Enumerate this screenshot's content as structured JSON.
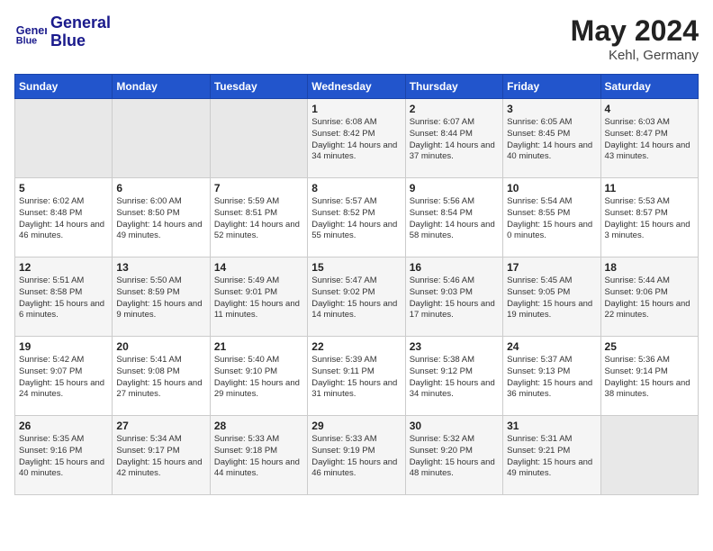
{
  "header": {
    "logo_text_top": "General",
    "logo_text_bottom": "Blue",
    "month_year": "May 2024",
    "location": "Kehl, Germany"
  },
  "days_of_week": [
    "Sunday",
    "Monday",
    "Tuesday",
    "Wednesday",
    "Thursday",
    "Friday",
    "Saturday"
  ],
  "weeks": [
    [
      {
        "num": "",
        "info": ""
      },
      {
        "num": "",
        "info": ""
      },
      {
        "num": "",
        "info": ""
      },
      {
        "num": "1",
        "info": "Sunrise: 6:08 AM\nSunset: 8:42 PM\nDaylight: 14 hours\nand 34 minutes."
      },
      {
        "num": "2",
        "info": "Sunrise: 6:07 AM\nSunset: 8:44 PM\nDaylight: 14 hours\nand 37 minutes."
      },
      {
        "num": "3",
        "info": "Sunrise: 6:05 AM\nSunset: 8:45 PM\nDaylight: 14 hours\nand 40 minutes."
      },
      {
        "num": "4",
        "info": "Sunrise: 6:03 AM\nSunset: 8:47 PM\nDaylight: 14 hours\nand 43 minutes."
      }
    ],
    [
      {
        "num": "5",
        "info": "Sunrise: 6:02 AM\nSunset: 8:48 PM\nDaylight: 14 hours\nand 46 minutes."
      },
      {
        "num": "6",
        "info": "Sunrise: 6:00 AM\nSunset: 8:50 PM\nDaylight: 14 hours\nand 49 minutes."
      },
      {
        "num": "7",
        "info": "Sunrise: 5:59 AM\nSunset: 8:51 PM\nDaylight: 14 hours\nand 52 minutes."
      },
      {
        "num": "8",
        "info": "Sunrise: 5:57 AM\nSunset: 8:52 PM\nDaylight: 14 hours\nand 55 minutes."
      },
      {
        "num": "9",
        "info": "Sunrise: 5:56 AM\nSunset: 8:54 PM\nDaylight: 14 hours\nand 58 minutes."
      },
      {
        "num": "10",
        "info": "Sunrise: 5:54 AM\nSunset: 8:55 PM\nDaylight: 15 hours\nand 0 minutes."
      },
      {
        "num": "11",
        "info": "Sunrise: 5:53 AM\nSunset: 8:57 PM\nDaylight: 15 hours\nand 3 minutes."
      }
    ],
    [
      {
        "num": "12",
        "info": "Sunrise: 5:51 AM\nSunset: 8:58 PM\nDaylight: 15 hours\nand 6 minutes."
      },
      {
        "num": "13",
        "info": "Sunrise: 5:50 AM\nSunset: 8:59 PM\nDaylight: 15 hours\nand 9 minutes."
      },
      {
        "num": "14",
        "info": "Sunrise: 5:49 AM\nSunset: 9:01 PM\nDaylight: 15 hours\nand 11 minutes."
      },
      {
        "num": "15",
        "info": "Sunrise: 5:47 AM\nSunset: 9:02 PM\nDaylight: 15 hours\nand 14 minutes."
      },
      {
        "num": "16",
        "info": "Sunrise: 5:46 AM\nSunset: 9:03 PM\nDaylight: 15 hours\nand 17 minutes."
      },
      {
        "num": "17",
        "info": "Sunrise: 5:45 AM\nSunset: 9:05 PM\nDaylight: 15 hours\nand 19 minutes."
      },
      {
        "num": "18",
        "info": "Sunrise: 5:44 AM\nSunset: 9:06 PM\nDaylight: 15 hours\nand 22 minutes."
      }
    ],
    [
      {
        "num": "19",
        "info": "Sunrise: 5:42 AM\nSunset: 9:07 PM\nDaylight: 15 hours\nand 24 minutes."
      },
      {
        "num": "20",
        "info": "Sunrise: 5:41 AM\nSunset: 9:08 PM\nDaylight: 15 hours\nand 27 minutes."
      },
      {
        "num": "21",
        "info": "Sunrise: 5:40 AM\nSunset: 9:10 PM\nDaylight: 15 hours\nand 29 minutes."
      },
      {
        "num": "22",
        "info": "Sunrise: 5:39 AM\nSunset: 9:11 PM\nDaylight: 15 hours\nand 31 minutes."
      },
      {
        "num": "23",
        "info": "Sunrise: 5:38 AM\nSunset: 9:12 PM\nDaylight: 15 hours\nand 34 minutes."
      },
      {
        "num": "24",
        "info": "Sunrise: 5:37 AM\nSunset: 9:13 PM\nDaylight: 15 hours\nand 36 minutes."
      },
      {
        "num": "25",
        "info": "Sunrise: 5:36 AM\nSunset: 9:14 PM\nDaylight: 15 hours\nand 38 minutes."
      }
    ],
    [
      {
        "num": "26",
        "info": "Sunrise: 5:35 AM\nSunset: 9:16 PM\nDaylight: 15 hours\nand 40 minutes."
      },
      {
        "num": "27",
        "info": "Sunrise: 5:34 AM\nSunset: 9:17 PM\nDaylight: 15 hours\nand 42 minutes."
      },
      {
        "num": "28",
        "info": "Sunrise: 5:33 AM\nSunset: 9:18 PM\nDaylight: 15 hours\nand 44 minutes."
      },
      {
        "num": "29",
        "info": "Sunrise: 5:33 AM\nSunset: 9:19 PM\nDaylight: 15 hours\nand 46 minutes."
      },
      {
        "num": "30",
        "info": "Sunrise: 5:32 AM\nSunset: 9:20 PM\nDaylight: 15 hours\nand 48 minutes."
      },
      {
        "num": "31",
        "info": "Sunrise: 5:31 AM\nSunset: 9:21 PM\nDaylight: 15 hours\nand 49 minutes."
      },
      {
        "num": "",
        "info": ""
      }
    ]
  ]
}
